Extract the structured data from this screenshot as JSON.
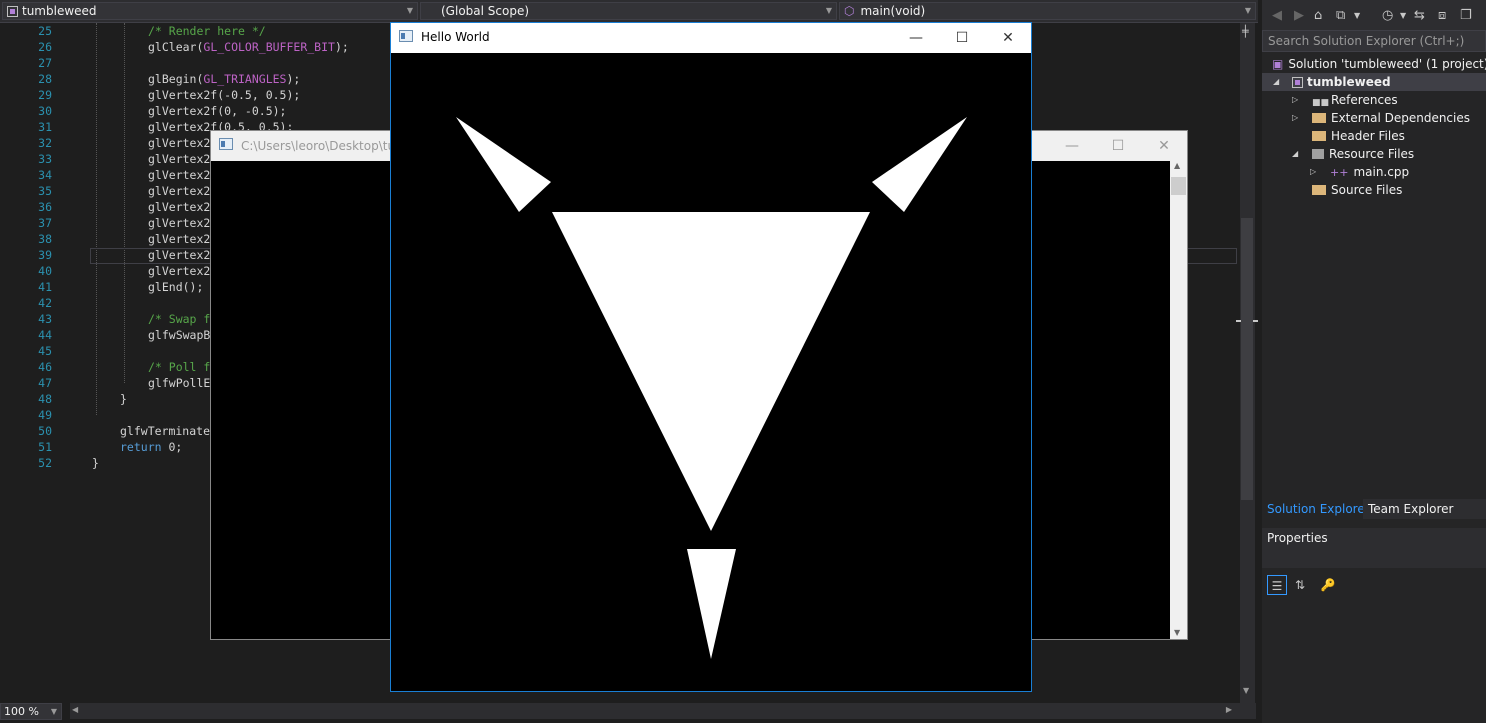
{
  "navbar": {
    "project": "tumbleweed",
    "scope": "(Global Scope)",
    "function": "main(void)"
  },
  "editor": {
    "lines": [
      {
        "n": "25",
        "text": "/* Render here */",
        "kind": "comment"
      },
      {
        "n": "26",
        "text": "glClear(",
        "macro": "GL_COLOR_BUFFER_BIT",
        "tail": ");",
        "kind": "macro"
      },
      {
        "n": "27",
        "text": "",
        "kind": "plain"
      },
      {
        "n": "28",
        "text": "glBegin(",
        "macro": "GL_TRIANGLES",
        "tail": ");",
        "kind": "macro"
      },
      {
        "n": "29",
        "text": "glVertex2f(-0.5, 0.5);",
        "kind": "plain"
      },
      {
        "n": "30",
        "text": "glVertex2f(0, -0.5);",
        "kind": "plain"
      },
      {
        "n": "31",
        "text": "glVertex2f(0.5, 0.5);",
        "kind": "plain"
      },
      {
        "n": "32",
        "text": "glVertex2",
        "kind": "plain"
      },
      {
        "n": "33",
        "text": "glVertex2",
        "kind": "plain"
      },
      {
        "n": "34",
        "text": "glVertex2",
        "kind": "plain"
      },
      {
        "n": "35",
        "text": "glVertex2",
        "kind": "plain"
      },
      {
        "n": "36",
        "text": "glVertex2",
        "kind": "plain"
      },
      {
        "n": "37",
        "text": "glVertex2",
        "kind": "plain"
      },
      {
        "n": "38",
        "text": "glVertex2",
        "kind": "plain"
      },
      {
        "n": "39",
        "text": "glVertex2",
        "kind": "plain"
      },
      {
        "n": "40",
        "text": "glVertex2",
        "kind": "plain"
      },
      {
        "n": "41",
        "text": "glEnd();",
        "kind": "plain"
      },
      {
        "n": "42",
        "text": "",
        "kind": "plain"
      },
      {
        "n": "43",
        "text": "/* Swap f",
        "kind": "comment"
      },
      {
        "n": "44",
        "text": "glfwSwapB",
        "kind": "plain"
      },
      {
        "n": "45",
        "text": "",
        "kind": "plain"
      },
      {
        "n": "46",
        "text": "/* Poll f",
        "kind": "comment"
      },
      {
        "n": "47",
        "text": "glfwPollE",
        "kind": "plain"
      },
      {
        "n": "48",
        "text": "}",
        "kind": "plain"
      },
      {
        "n": "49",
        "text": "",
        "kind": "plain"
      },
      {
        "n": "50",
        "text": "glfwTerminate",
        "kind": "plain"
      },
      {
        "n": "51",
        "text": "return",
        "tail": " 0;",
        "kind": "keyword"
      },
      {
        "n": "52",
        "text": "}",
        "kind": "plain"
      }
    ],
    "zoom": "100 %"
  },
  "console_window": {
    "title": "C:\\Users\\leoro\\Desktop\\tum"
  },
  "hello_window": {
    "title": "Hello World",
    "background": "#000000",
    "fill": "#ffffff"
  },
  "solution_explorer": {
    "search_placeholder": "Search Solution Explorer (Ctrl+;)",
    "solution": "Solution 'tumbleweed' (1 project)",
    "project": "tumbleweed",
    "items": [
      "References",
      "External Dependencies",
      "Header Files",
      "Resource Files",
      "main.cpp",
      "Source Files"
    ],
    "tabs": [
      "Solution Explorer",
      "Team Explorer"
    ]
  },
  "properties": {
    "title": "Properties"
  },
  "colors": {
    "accent": "#1a7fd4",
    "comment": "#57a64a",
    "keyword": "#569cd6",
    "macro": "#bd63c5",
    "line_number": "#2b91af"
  }
}
